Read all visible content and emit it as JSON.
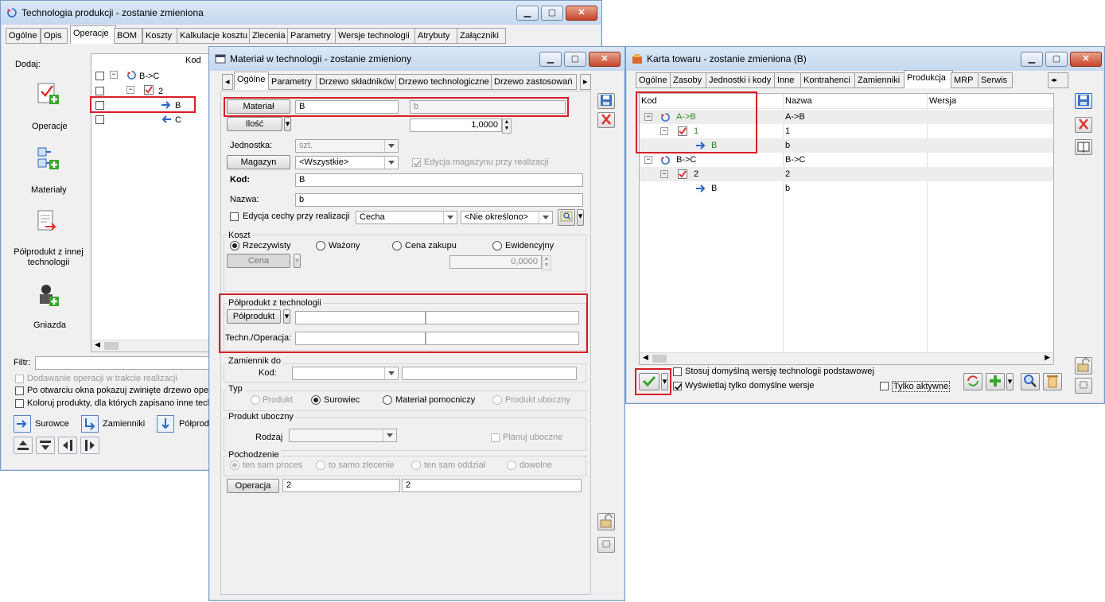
{
  "win1": {
    "title": "Technologia produkcji - zostanie zmieniona",
    "tabs": [
      "Ogólne",
      "Opis",
      "Operacje",
      "BOM",
      "Koszty",
      "Kalkulacje kosztu",
      "Zlecenia",
      "Parametry",
      "Wersje technologii",
      "Atrybuty",
      "Załączniki"
    ],
    "dodaj_label": "Dodaj:",
    "sidebar": [
      "Operacje",
      "Materiały",
      "Półprodukt z innej technologii",
      "Gniazda"
    ],
    "tree_header": "Kod",
    "tree": [
      "B->C",
      "2",
      "B",
      "C"
    ],
    "filter_label": "Filtr:",
    "checkboxes": [
      "Dodawanie operacji w trakcie realizacji",
      "Po otwarciu okna pokazuj zwinięte drzewo operacji",
      "Koloruj produkty, dla których zapisano inne technologie"
    ],
    "legend": [
      "Surowce",
      "Zamienniki",
      "Półprodukty"
    ]
  },
  "win2": {
    "title": "Materiał w technologii - zostanie zmieniony",
    "tabs": [
      "Ogólne",
      "Parametry",
      "Drzewo składników",
      "Drzewo technologiczne",
      "Drzewo zastosowań"
    ],
    "material_btn": "Materiał",
    "material_code": "B",
    "material_name": "b",
    "ilosc_btn": "Ilość",
    "ilosc_value": "1,0000",
    "jednostka_label": "Jednostka:",
    "jednostka_value": "szt.",
    "magazyn_btn": "Magazyn",
    "magazyn_value": "<Wszystkie>",
    "edycja_magazynu": "Edycja magazynu przy realizacji",
    "kod_label": "Kod:",
    "kod_value": "B",
    "nazwa_label": "Nazwa:",
    "nazwa_value": "b",
    "edycja_cechy": "Edycja cechy przy realizacji",
    "cecha_value": "Cecha",
    "nieokreslono": "<Nie określono>",
    "koszt_title": "Koszt",
    "koszt_options": [
      "Rzeczywisty",
      "Ważony",
      "Cena zakupu",
      "Ewidencyjny"
    ],
    "cena_btn": "Cena",
    "cena_value": "0,0000",
    "polprodukt_title": "Półprodukt z technologii",
    "polprodukt_btn": "Półprodukt",
    "techn_label": "Techn./Operacja:",
    "zamiennik_title": "Zamiennik do",
    "zamiennik_kod": "Kod:",
    "typ_title": "Typ",
    "typ_options": [
      "Produkt",
      "Surowiec",
      "Materiał pomocniczy",
      "Produkt uboczny"
    ],
    "uboczny_title": "Produkt uboczny",
    "rodzaj_label": "Rodzaj",
    "planuj": "Planuj uboczne",
    "pochodzenie_title": "Pochodzenie",
    "pochodzenie_options": [
      "ten sam proces",
      "to samo zlecenie",
      "ten sam oddział",
      "dowolne"
    ],
    "operacja_btn": "Operacja",
    "operacja_val1": "2",
    "operacja_val2": "2"
  },
  "win3": {
    "title": "Karta towaru - zostanie zmieniona (B)",
    "tabs": [
      "Ogólne",
      "Zasoby",
      "Jednostki i kody",
      "Inne",
      "Kontrahenci",
      "Zamienniki",
      "Produkcja",
      "MRP",
      "Serwis"
    ],
    "columns": [
      "Kod",
      "Nazwa",
      "Wersja"
    ],
    "rows": [
      {
        "kod": "A->B",
        "nazwa": "A->B"
      },
      {
        "kod": "1",
        "nazwa": "1"
      },
      {
        "kod": "B",
        "nazwa": "b"
      },
      {
        "kod": "B->C",
        "nazwa": "B->C"
      },
      {
        "kod": "2",
        "nazwa": "2"
      },
      {
        "kod": "B",
        "nazwa": "b"
      }
    ],
    "stosuj": "Stosuj domyślną wersję technologii podstawowej",
    "wyswietlaj": "Wyświetlaj tylko domyślne wersje",
    "tylko_aktywne": "Tylko aktywne"
  },
  "colors": {
    "highlight": "#d81e27",
    "green_text": "#2a8a1f",
    "blue_arrow": "#2e66c8"
  }
}
